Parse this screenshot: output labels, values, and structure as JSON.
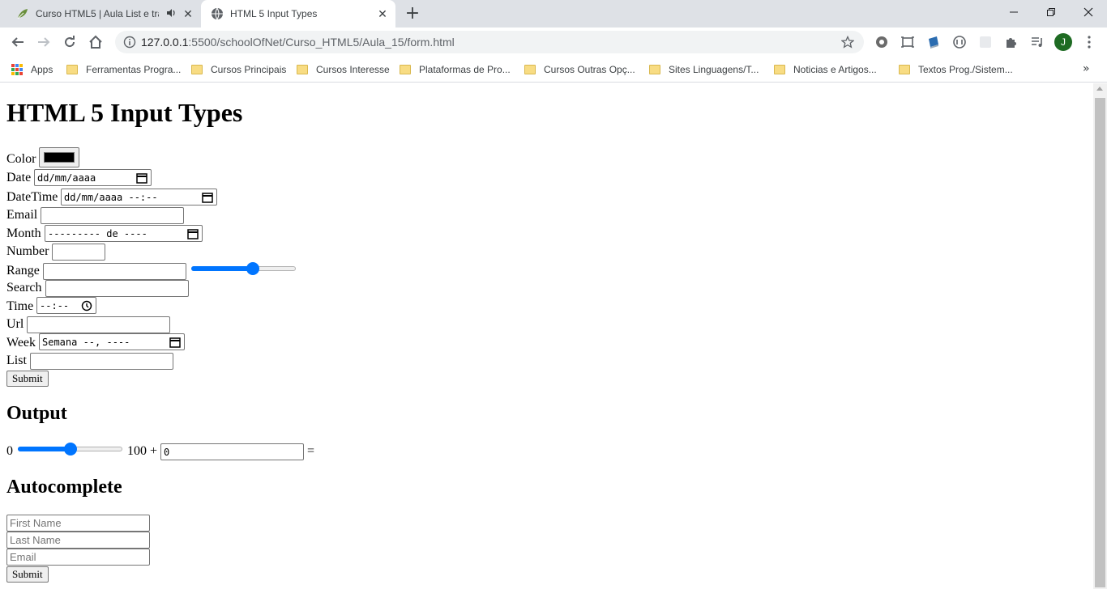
{
  "browser": {
    "tabs": [
      {
        "title": "Curso HTML5 | Aula List e tra",
        "active": false,
        "icon": "leaf-favicon-icon",
        "audio": true
      },
      {
        "title": "HTML 5 Input Types",
        "active": true,
        "icon": "globe-favicon-icon",
        "audio": false
      }
    ],
    "url": {
      "host": "127.0.0.1",
      "rest": ":5500/schoolOfNet/Curso_HTML5/Aula_15/form.html"
    },
    "profile_initial": "J",
    "bookmarks": [
      {
        "label": "Apps",
        "type": "apps"
      },
      {
        "label": "Ferramentas Progra...",
        "type": "folder"
      },
      {
        "label": "Cursos Principais",
        "type": "folder"
      },
      {
        "label": "Cursos Interesse",
        "type": "folder"
      },
      {
        "label": "Plataformas de Pro...",
        "type": "folder"
      },
      {
        "label": "Cursos Outras Opç...",
        "type": "folder"
      },
      {
        "label": "Sites Linguagens/T...",
        "type": "folder"
      },
      {
        "label": "Noticias e Artigos...",
        "type": "folder"
      },
      {
        "label": "Textos Prog./Sistem...",
        "type": "folder"
      }
    ],
    "bookmarks_overflow": "»"
  },
  "page": {
    "title": "HTML 5 Input Types",
    "form": {
      "color": {
        "label": "Color",
        "value": "#000000"
      },
      "date": {
        "label": "Date",
        "value": "dd/mm/aaaa"
      },
      "datetime": {
        "label": "DateTime",
        "value": "dd/mm/aaaa --:--"
      },
      "email": {
        "label": "Email",
        "value": ""
      },
      "month": {
        "label": "Month",
        "value": "--------- de ----"
      },
      "number": {
        "label": "Number",
        "value": ""
      },
      "range": {
        "label": "Range",
        "value": "",
        "slider_fraction": 0.6
      },
      "search": {
        "label": "Search",
        "value": ""
      },
      "time": {
        "label": "Time",
        "value": "--:--"
      },
      "url": {
        "label": "Url",
        "value": ""
      },
      "week": {
        "label": "Week",
        "value": "Semana --, ----"
      },
      "list": {
        "label": "List",
        "value": ""
      },
      "submit": "Submit"
    },
    "output": {
      "heading": "Output",
      "left": "0",
      "slider_fraction": 0.5,
      "right": "100 +",
      "value": "0",
      "equals": "="
    },
    "autocomplete": {
      "heading": "Autocomplete",
      "first_name_placeholder": "First Name",
      "last_name_placeholder": "Last Name",
      "email_placeholder": "Email",
      "submit": "Submit"
    }
  },
  "colors": {
    "accent": "#0075ff",
    "tabstrip": "#dee1e6",
    "avatar": "#1e6b23"
  }
}
